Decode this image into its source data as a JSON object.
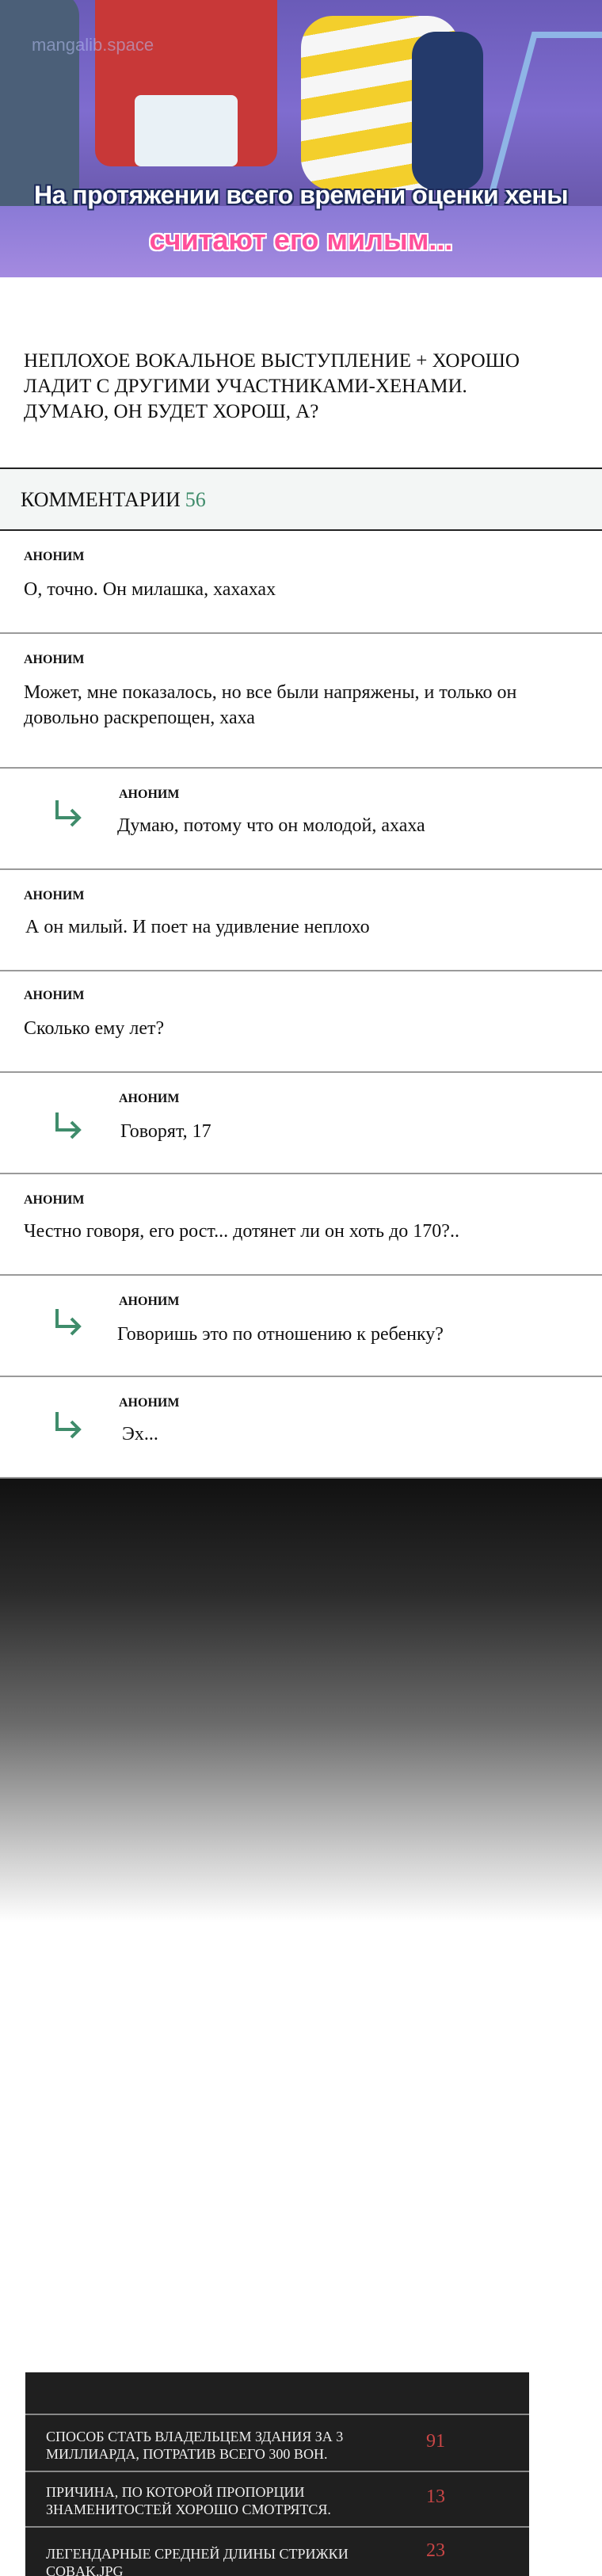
{
  "panel": {
    "watermark": "mangalib.space",
    "caption_line1": "На протяжении всего времени оценки хены",
    "caption_line2": "считают его милым..."
  },
  "intro": "Неплохое вокальное выступление + хорошо ладит с другими участниками-хенами. Думаю, он будет хорош, а?",
  "comments": {
    "label": "Комментарии",
    "count": "56",
    "items": [
      {
        "author": "Аноним",
        "text": "О, точно. Он милашка, хахахах"
      },
      {
        "author": "Аноним",
        "text": "Может, мне показалось, но все были напряжены, и только он довольно раскрепощен, хаха"
      },
      {
        "author": "Аноним",
        "text": "Думаю, потому что он молодой, ахаха"
      },
      {
        "author": "Аноним",
        "text": "А он милый. И поет на удивление неплохо"
      },
      {
        "author": "Аноним",
        "text": "Сколько ему лет?"
      },
      {
        "author": "Аноним",
        "text": "Говорят, 17"
      },
      {
        "author": "Аноним",
        "text": "Честно говоря, его рост... дотянет ли он хоть до 170?.."
      },
      {
        "author": "Аноним",
        "text": "Говоришь это по отношению к ребенку?"
      },
      {
        "author": "Аноним",
        "text": "Эх..."
      }
    ]
  },
  "list": [
    {
      "title": "Способ стать владельцем здания за 3 миллиарда, потратив всего 300 вон.",
      "num": "91"
    },
    {
      "title": "Причина, по которой пропорции знаменитостей хорошо смотрятся.",
      "num": "13"
    },
    {
      "title": "Легендарные средней длины стрижки Cobak.jpg",
      "num": "23"
    }
  ],
  "colors": {
    "accent_green": "#3f8c6b",
    "number_red": "#c94646"
  }
}
